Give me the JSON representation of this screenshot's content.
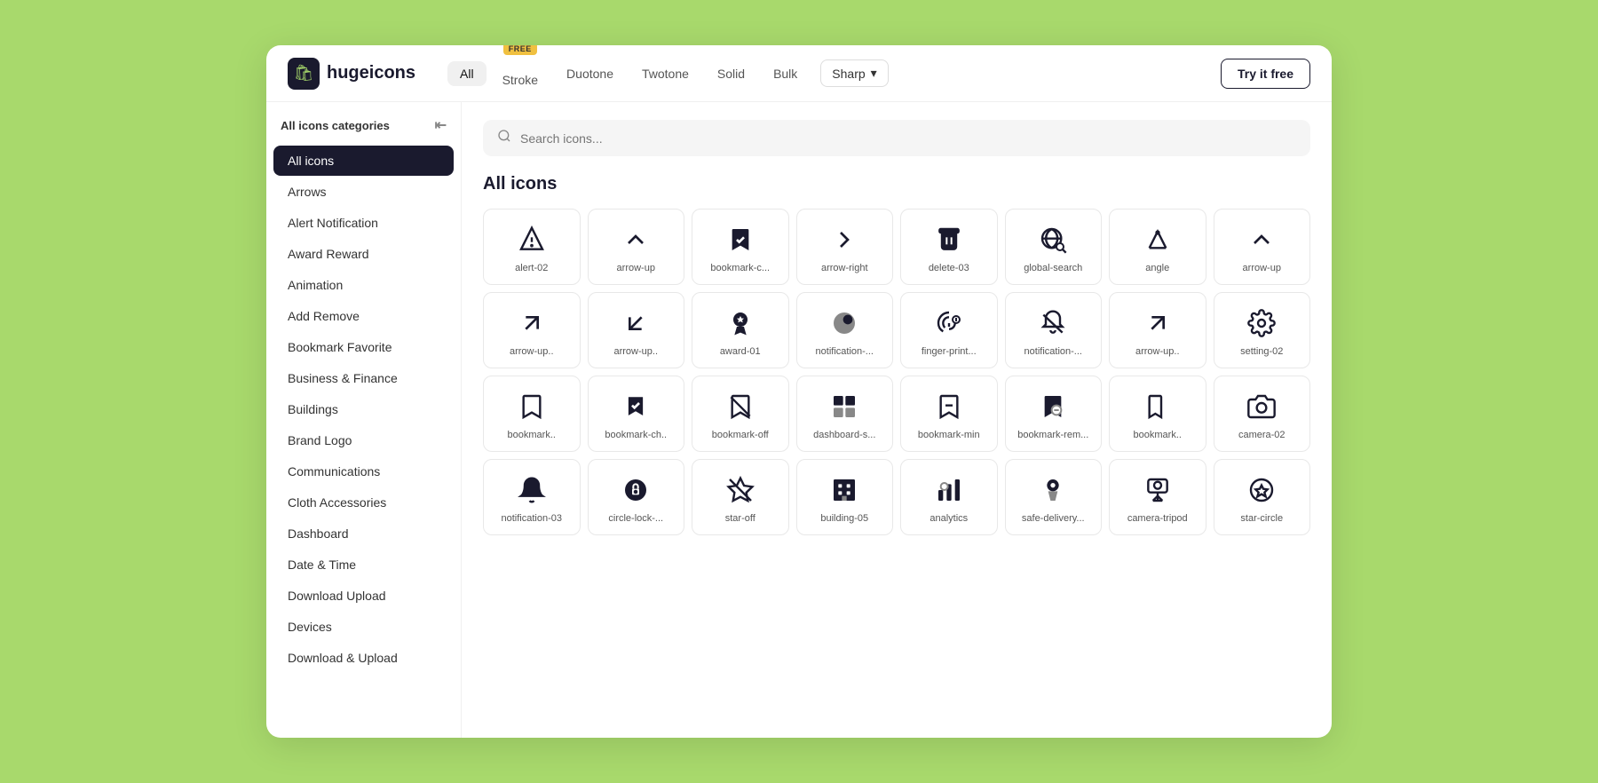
{
  "logo": {
    "icon": "🛍",
    "text": "hugeicons"
  },
  "header": {
    "tabs": [
      {
        "id": "all",
        "label": "All",
        "active": true
      },
      {
        "id": "stroke",
        "label": "Stroke",
        "badge": "FREE"
      },
      {
        "id": "duotone",
        "label": "Duotone"
      },
      {
        "id": "twotone",
        "label": "Twotone"
      },
      {
        "id": "solid",
        "label": "Solid"
      },
      {
        "id": "bulk",
        "label": "Bulk"
      }
    ],
    "shape": "Sharp",
    "try_it_free": "Try it free"
  },
  "sidebar": {
    "header": "All icons categories",
    "items": [
      {
        "id": "all-icons",
        "label": "All icons",
        "active": true
      },
      {
        "id": "arrows",
        "label": "Arrows"
      },
      {
        "id": "alert-notification",
        "label": "Alert Notification"
      },
      {
        "id": "award-reward",
        "label": "Award Reward"
      },
      {
        "id": "animation",
        "label": "Animation"
      },
      {
        "id": "add-remove",
        "label": "Add Remove"
      },
      {
        "id": "bookmark-favorite",
        "label": "Bookmark Favorite"
      },
      {
        "id": "business-finance",
        "label": "Business & Finance"
      },
      {
        "id": "buildings",
        "label": "Buildings"
      },
      {
        "id": "brand-logo",
        "label": "Brand Logo"
      },
      {
        "id": "communications",
        "label": "Communications"
      },
      {
        "id": "cloth-accessories",
        "label": "Cloth Accessories"
      },
      {
        "id": "dashboard",
        "label": "Dashboard"
      },
      {
        "id": "date-time",
        "label": "Date & Time"
      },
      {
        "id": "download-upload",
        "label": "Download Upload"
      },
      {
        "id": "devices",
        "label": "Devices"
      },
      {
        "id": "download-upload-2",
        "label": "Download & Upload"
      }
    ]
  },
  "search": {
    "placeholder": "Search icons..."
  },
  "content": {
    "title": "All icons",
    "icons": [
      {
        "id": "alert-02",
        "label": "alert-02"
      },
      {
        "id": "arrow-up",
        "label": "arrow-up"
      },
      {
        "id": "bookmark-c",
        "label": "bookmark-c..."
      },
      {
        "id": "arrow-right",
        "label": "arrow-right"
      },
      {
        "id": "delete-03",
        "label": "delete-03"
      },
      {
        "id": "global-search",
        "label": "global-search"
      },
      {
        "id": "angle",
        "label": "angle"
      },
      {
        "id": "arrow-up-2",
        "label": "arrow-up"
      },
      {
        "id": "arrow-up-diag",
        "label": "arrow-up.."
      },
      {
        "id": "arrow-down-diag",
        "label": "arrow-up.."
      },
      {
        "id": "award-01",
        "label": "award-01"
      },
      {
        "id": "notification-1",
        "label": "notification-..."
      },
      {
        "id": "finger-print",
        "label": "finger-print..."
      },
      {
        "id": "notification-2",
        "label": "notification-..."
      },
      {
        "id": "arrow-up-3",
        "label": "arrow-up.."
      },
      {
        "id": "setting-02",
        "label": "setting-02"
      },
      {
        "id": "bookmark-1",
        "label": "bookmark.."
      },
      {
        "id": "bookmark-ch",
        "label": "bookmark-ch.."
      },
      {
        "id": "bookmark-off",
        "label": "bookmark-off"
      },
      {
        "id": "dashboard-s",
        "label": "dashboard-s..."
      },
      {
        "id": "bookmark-min",
        "label": "bookmark-min"
      },
      {
        "id": "bookmark-rem",
        "label": "bookmark-rem..."
      },
      {
        "id": "bookmark-2",
        "label": "bookmark.."
      },
      {
        "id": "camera-02",
        "label": "camera-02"
      },
      {
        "id": "notification-03",
        "label": "notification-03"
      },
      {
        "id": "circle-lock",
        "label": "circle-lock-..."
      },
      {
        "id": "star-off",
        "label": "star-off"
      },
      {
        "id": "building-05",
        "label": "building-05"
      },
      {
        "id": "analytics",
        "label": "analytics"
      },
      {
        "id": "safe-delivery",
        "label": "safe-delivery..."
      },
      {
        "id": "camera-tripod",
        "label": "camera-tripod"
      },
      {
        "id": "star-circle",
        "label": "star-circle"
      }
    ]
  }
}
